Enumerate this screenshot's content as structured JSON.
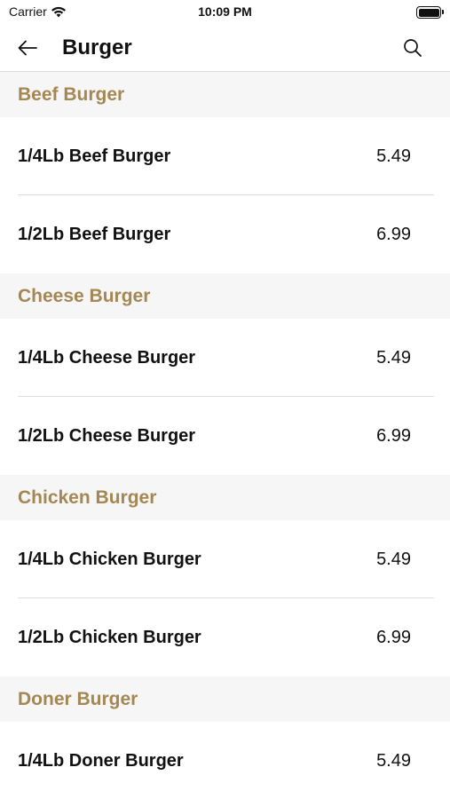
{
  "status_bar": {
    "carrier": "Carrier",
    "time": "10:09 PM",
    "icons": [
      "wifi-icon",
      "battery-icon"
    ]
  },
  "nav": {
    "title": "Burger",
    "icons": [
      "back-arrow-icon",
      "search-icon"
    ]
  },
  "colors": {
    "section_text": "#a48752",
    "section_bg": "#f6f6f6",
    "separator": "#dcdcdc"
  },
  "sections": [
    {
      "title": "Beef Burger",
      "items": [
        {
          "name": "1/4Lb Beef Burger",
          "price": "5.49"
        },
        {
          "name": "1/2Lb Beef Burger",
          "price": "6.99"
        }
      ]
    },
    {
      "title": "Cheese Burger",
      "items": [
        {
          "name": "1/4Lb Cheese Burger",
          "price": "5.49"
        },
        {
          "name": "1/2Lb Cheese Burger",
          "price": "6.99"
        }
      ]
    },
    {
      "title": "Chicken Burger",
      "items": [
        {
          "name": "1/4Lb Chicken Burger",
          "price": "5.49"
        },
        {
          "name": "1/2Lb Chicken Burger",
          "price": "6.99"
        }
      ]
    },
    {
      "title": "Doner Burger",
      "items": [
        {
          "name": "1/4Lb Doner Burger",
          "price": "5.49"
        }
      ]
    }
  ]
}
